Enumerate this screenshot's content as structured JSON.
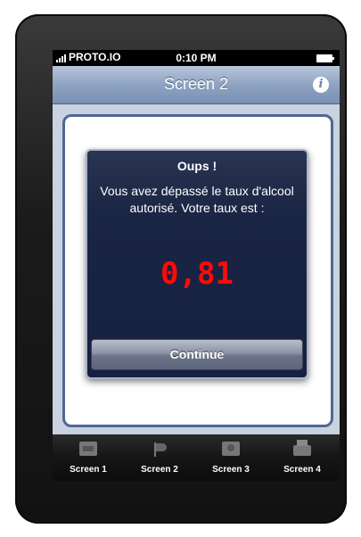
{
  "status_bar": {
    "carrier": "PROTO.IO",
    "time": "0:10 PM"
  },
  "nav": {
    "title": "Screen 2",
    "info_icon": "info-icon"
  },
  "alert": {
    "title": "Oups !",
    "message": "Vous avez dépassé le taux d'alcool autorisé. Votre taux est :",
    "value": "0,81",
    "value_color": "#ff0a0a",
    "button_label": "Continue"
  },
  "tabs": [
    {
      "label": "Screen 1",
      "icon": "media-icon"
    },
    {
      "label": "Screen 2",
      "icon": "flag-icon"
    },
    {
      "label": "Screen 3",
      "icon": "badge-icon"
    },
    {
      "label": "Screen 4",
      "icon": "printer-icon"
    }
  ]
}
